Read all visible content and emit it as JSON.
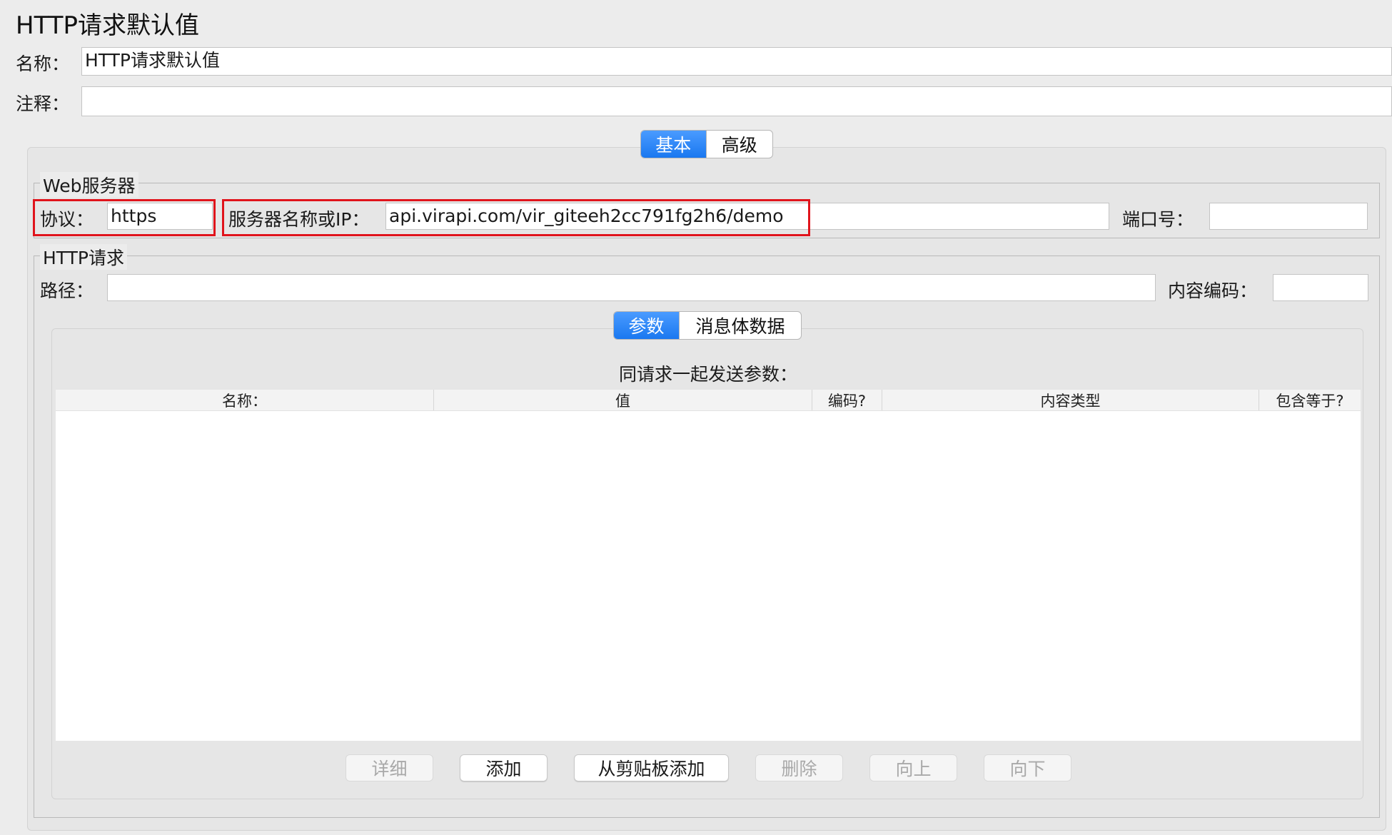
{
  "header": {
    "title": "HTTP请求默认值"
  },
  "name_field": {
    "label": "名称：",
    "value": "HTTP请求默认值"
  },
  "comment_field": {
    "label": "注释：",
    "value": ""
  },
  "main_tabs": {
    "active": "基本",
    "inactive": "高级"
  },
  "web_server": {
    "legend": "Web服务器",
    "protocol_label": "协议：",
    "protocol_value": "https",
    "server_label": "服务器名称或IP：",
    "server_value": "api.virapi.com/vir_giteeh2cc791fg2h6/demo",
    "port_label": "端口号：",
    "port_value": ""
  },
  "http_request": {
    "legend": "HTTP请求",
    "path_label": "路径：",
    "path_value": "",
    "encoding_label": "内容编码：",
    "encoding_value": ""
  },
  "sub_tabs": {
    "active": "参数",
    "inactive": "消息体数据"
  },
  "params": {
    "caption": "同请求一起发送参数：",
    "columns": [
      "名称：",
      "值",
      "编码?",
      "内容类型",
      "包含等于?"
    ]
  },
  "buttons": {
    "detail": "详细",
    "add": "添加",
    "add_clipboard": "从剪贴板添加",
    "delete": "删除",
    "up": "向上",
    "down": "向下"
  },
  "colors": {
    "accent": "#1a78f0",
    "highlight": "#e0141c"
  }
}
